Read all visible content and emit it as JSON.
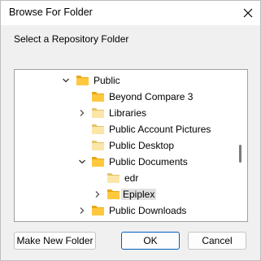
{
  "window": {
    "title": "Browse For Folder"
  },
  "prompt": "Select a Repository Folder",
  "tree": {
    "items": [
      {
        "label": "Public",
        "expanded": true,
        "has_children": true
      },
      {
        "label": "Beyond Compare 3",
        "expanded": false,
        "has_children": false
      },
      {
        "label": "Libraries",
        "expanded": false,
        "has_children": true
      },
      {
        "label": "Public Account Pictures",
        "expanded": false,
        "has_children": false
      },
      {
        "label": "Public Desktop",
        "expanded": false,
        "has_children": false
      },
      {
        "label": "Public Documents",
        "expanded": true,
        "has_children": true
      },
      {
        "label": "edr",
        "expanded": false,
        "has_children": false
      },
      {
        "label": "Epiplex",
        "expanded": false,
        "has_children": true,
        "selected": true
      },
      {
        "label": "Public Downloads",
        "expanded": false,
        "has_children": true
      }
    ]
  },
  "buttons": {
    "new_folder": "Make New Folder",
    "ok": "OK",
    "cancel": "Cancel"
  },
  "colors": {
    "folder": "#ffc83d",
    "folder_dark": "#e6a817",
    "primary_border": "#005fb8",
    "selection": "#e1e1e1"
  }
}
